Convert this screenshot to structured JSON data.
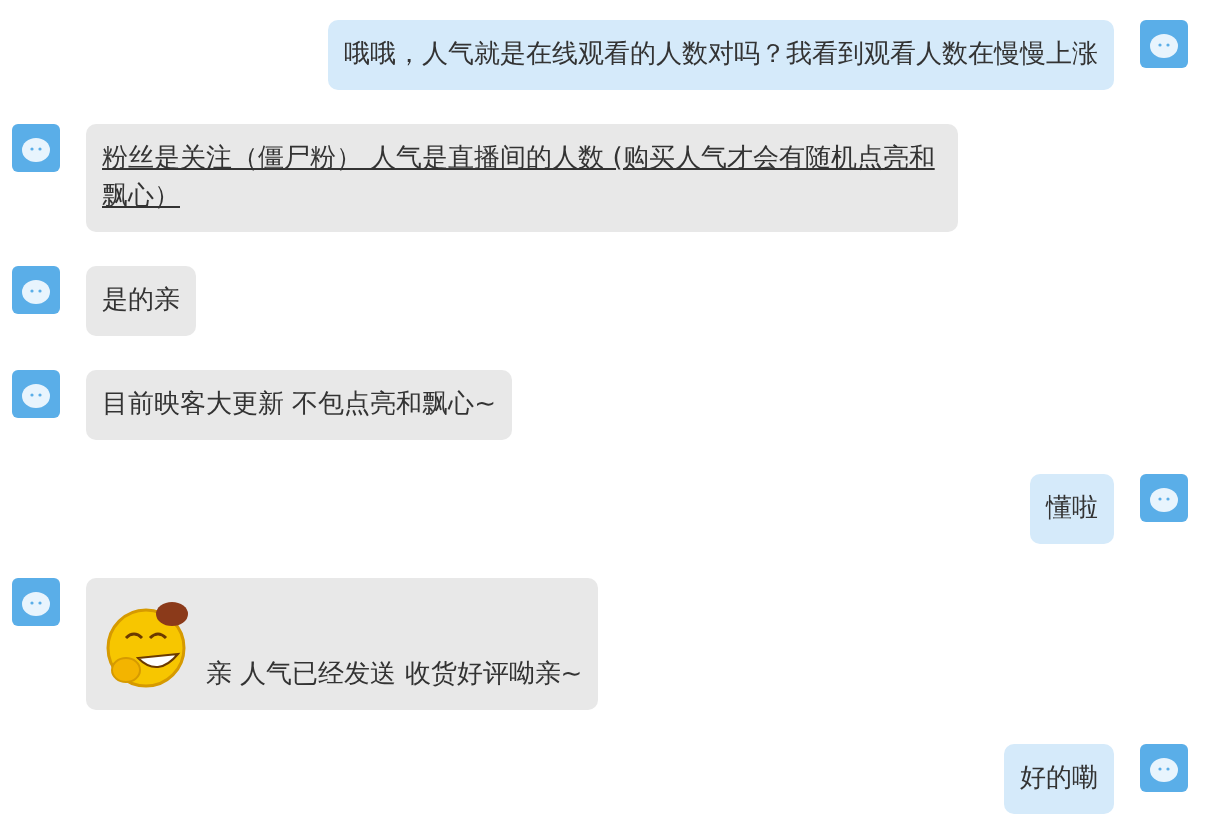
{
  "messages": [
    {
      "outgoing": true,
      "kind": "text",
      "text": "哦哦，人气就是在线观看的人数对吗？我看到观看人数在慢慢上涨"
    },
    {
      "outgoing": false,
      "kind": "underlined_text",
      "text": "粉丝是关注（僵尸粉） 人气是直播间的人数 (购买人气才会有随机点亮和飘心）"
    },
    {
      "outgoing": false,
      "kind": "text",
      "text": "是的亲"
    },
    {
      "outgoing": false,
      "kind": "text",
      "text": "目前映客大更新 不包点亮和飘心~"
    },
    {
      "outgoing": true,
      "kind": "text",
      "text": "懂啦"
    },
    {
      "outgoing": false,
      "kind": "sticker",
      "text": "亲 人气已经发送 收货好评呦亲~"
    },
    {
      "outgoing": true,
      "kind": "text",
      "text": "好的嘞"
    }
  ]
}
